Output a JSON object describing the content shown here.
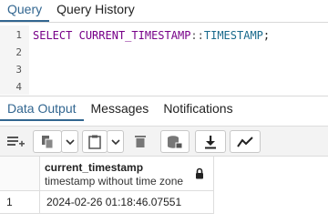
{
  "top_tabs": [
    {
      "label": "Query",
      "active": true
    },
    {
      "label": "Query History",
      "active": false
    }
  ],
  "editor": {
    "line_numbers": [
      "1",
      "2",
      "3",
      "4"
    ],
    "code": {
      "kw1": "SELECT",
      "kw2": "CURRENT_TIMESTAMP",
      "op": "::",
      "type": "TIMESTAMP",
      "end": ";"
    }
  },
  "bottom_tabs": [
    {
      "label": "Data Output",
      "active": true
    },
    {
      "label": "Messages",
      "active": false
    },
    {
      "label": "Notifications",
      "active": false
    }
  ],
  "toolbar": {
    "icons": [
      "add-row-icon",
      "copy-icon",
      "dropdown-chevron-icon",
      "paste-icon",
      "dropdown-chevron-icon",
      "delete-icon",
      "save-data-icon",
      "download-icon",
      "graph-icon"
    ]
  },
  "grid": {
    "column": {
      "name": "current_timestamp",
      "type": "timestamp without time zone"
    },
    "rows": [
      {
        "num": "1",
        "value": "2024-02-26 01:18:46.07551"
      }
    ]
  },
  "colors": {
    "accent": "#326690"
  }
}
